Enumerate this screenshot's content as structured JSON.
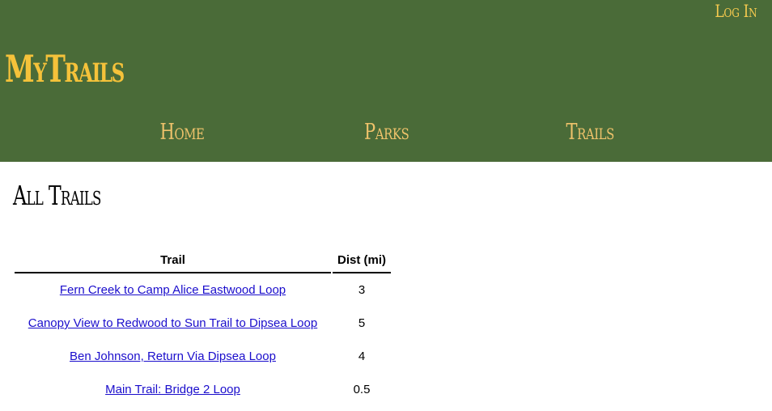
{
  "header": {
    "login_label": "Log In",
    "brand": "MyTrails",
    "nav": [
      {
        "label": "Home"
      },
      {
        "label": "Parks"
      },
      {
        "label": "Trails"
      }
    ]
  },
  "main": {
    "title": "All Trails",
    "table": {
      "columns": [
        "Trail",
        "Dist (mi)"
      ],
      "rows": [
        {
          "trail": "Fern Creek to Camp Alice Eastwood Loop",
          "dist": "3"
        },
        {
          "trail": "Canopy View to Redwood to Sun Trail to Dipsea Loop",
          "dist": "5"
        },
        {
          "trail": "Ben Johnson, Return Via Dipsea Loop",
          "dist": "4"
        },
        {
          "trail": "Main Trail: Bridge 2 Loop",
          "dist": "0.5"
        }
      ]
    }
  },
  "colors": {
    "header_bg": "#4a6b38",
    "brand": "#f5c23a",
    "nav_link": "#efc36b",
    "link": "#1a0dcc"
  }
}
